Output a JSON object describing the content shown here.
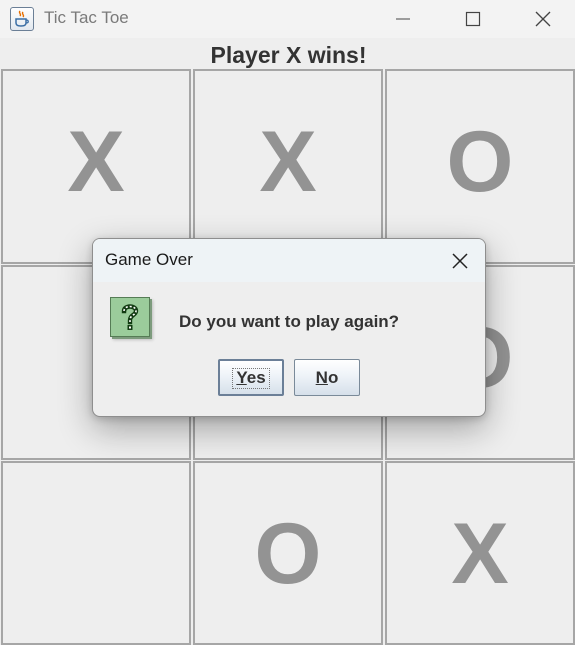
{
  "window": {
    "title": "Tic Tac Toe",
    "icon": "java-coffee-cup-icon"
  },
  "status": "Player X wins!",
  "board": [
    "X",
    "X",
    "O",
    "",
    "",
    "O",
    "",
    "O",
    "X"
  ],
  "dialog": {
    "title": "Game Over",
    "message": "Do you want to play again?",
    "icon": "question-icon",
    "buttons": {
      "yes": {
        "mnemonic": "Y",
        "rest": "es"
      },
      "no": {
        "mnemonic": "N",
        "rest": "o"
      }
    }
  },
  "colors": {
    "mark": "#939393",
    "grid": "#a6a6a6",
    "background": "#eeeeee",
    "dialog_titlebar": "#eef3f6",
    "question_icon": "#9bcc9b"
  }
}
